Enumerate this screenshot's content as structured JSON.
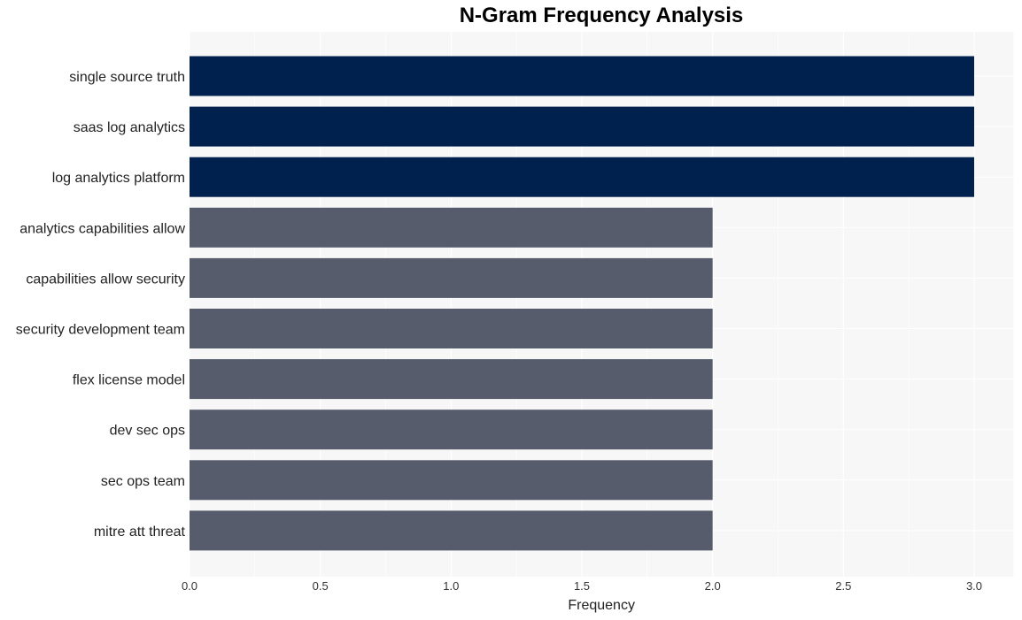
{
  "chart_data": {
    "type": "bar",
    "orientation": "horizontal",
    "title": "N-Gram Frequency Analysis",
    "xlabel": "Frequency",
    "ylabel": "",
    "xlim": [
      0,
      3.15
    ],
    "xticks": [
      "0.0",
      "0.5",
      "1.0",
      "1.5",
      "2.0",
      "2.5",
      "3.0"
    ],
    "grid": true,
    "categories": [
      "single source truth",
      "saas log analytics",
      "log analytics platform",
      "analytics capabilities allow",
      "capabilities allow security",
      "security development team",
      "flex license model",
      "dev sec ops",
      "sec ops team",
      "mitre att threat"
    ],
    "values": [
      3,
      3,
      3,
      2,
      2,
      2,
      2,
      2,
      2,
      2
    ],
    "colors": {
      "top": "#00214e",
      "other": "#575c6d",
      "plot_bg": "#f7f7f7",
      "grid": "#ffffff"
    }
  }
}
